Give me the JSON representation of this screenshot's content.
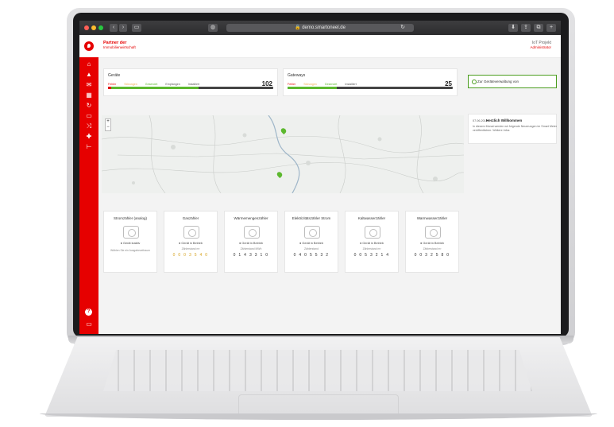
{
  "browser": {
    "url": "demo.smartoneel.de",
    "traffic_lights": [
      "#ff5f57",
      "#febc2e",
      "#28c840"
    ]
  },
  "header": {
    "brand_line1": "Partner der",
    "brand_line2": "Immobilienwirtschaft",
    "user_line1": "IoT Projekt",
    "user_line2": "Administrator"
  },
  "colors": {
    "accent": "#e60000",
    "ok": "#5cb82e",
    "warn": "#f0ad4e"
  },
  "sidebar": {
    "icons": [
      "home-icon",
      "alert-icon",
      "mail-icon",
      "building-icon",
      "refresh-icon",
      "meter-icon",
      "shuffle-icon",
      "puzzle-icon",
      "link-icon"
    ],
    "bottom_icons": [
      "help-icon",
      "monitor-icon"
    ]
  },
  "cards": {
    "geraete": {
      "title": "Geräte",
      "legend": [
        "Fehler",
        "Störungen",
        "Gesendet",
        "Empfangen",
        "Installiert"
      ],
      "count": "102"
    },
    "gateways": {
      "title": "Gateways",
      "legend": [
        "Fehler",
        "Störungen",
        "Gesendet",
        "Installiert"
      ],
      "count": "25"
    }
  },
  "link": {
    "label": "Zur Geräteverwaltung von"
  },
  "news": {
    "date": "07.06.2019",
    "title": "Herzlich Willkommen",
    "text": "In diesem Monat werden wir folgende Neuerungen im Smart Meter veröffentlichen. Weitere Infos"
  },
  "meters": [
    {
      "title": "Stromzähler (analog)",
      "status": "Gerät inaktiv",
      "sub": "Wählen Sie ein Ausgabezeitraum",
      "digits": ""
    },
    {
      "title": "Gaszähler",
      "status": "Gerät in Betrieb",
      "sub": "Zählerstand m³",
      "digits": "0 0 0 3 5 4 0"
    },
    {
      "title": "Wärmemengenzähler",
      "status": "Gerät in Betrieb",
      "sub": "Zählerstand MWh",
      "digits": "0 1 4 3 3 1 0"
    },
    {
      "title": "Elektrizitätszähler Strom",
      "status": "Gerät in Betrieb",
      "sub": "Zählerstand",
      "digits": "0 4 0 5 5 3 2"
    },
    {
      "title": "Kaltwasserzähler",
      "status": "Gerät in Betrieb",
      "sub": "Zählerstand m³",
      "digits": "0 0 5 3 2 1 4"
    },
    {
      "title": "Warmwasserzähler",
      "status": "Gerät in Betrieb",
      "sub": "Zählerstand m³",
      "digits": "0 0 3 2 5 8 0"
    }
  ]
}
